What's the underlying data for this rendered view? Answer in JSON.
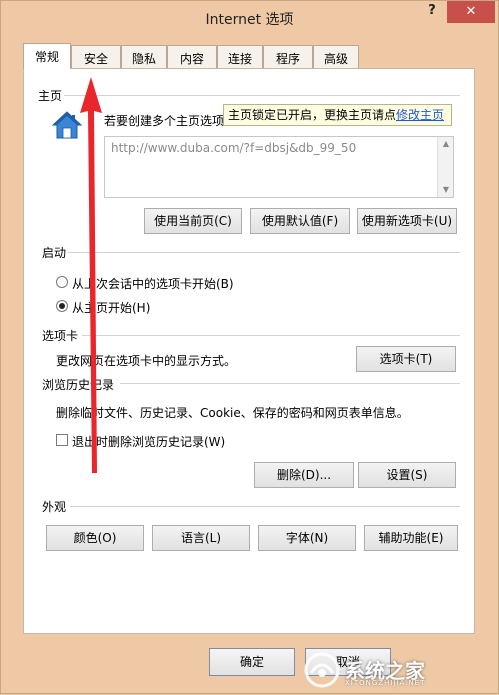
{
  "window": {
    "title": "Internet 选项",
    "help": "?",
    "close": "✕"
  },
  "tabs": [
    {
      "label": "常规",
      "active": true
    },
    {
      "label": "安全"
    },
    {
      "label": "隐私"
    },
    {
      "label": "内容"
    },
    {
      "label": "连接"
    },
    {
      "label": "程序"
    },
    {
      "label": "高级"
    }
  ],
  "homepage": {
    "section": "主页",
    "description": "若要创建多个主页选项",
    "url": "http://www.duba.com/?f=dbsj&db_99_50",
    "tooltip_text": "主页锁定已开启，更换主页请点",
    "tooltip_link": "修改主页",
    "btn_current": "使用当前页(C)",
    "btn_default": "使用默认值(F)",
    "btn_newtab": "使用新选项卡(U)"
  },
  "startup": {
    "section": "启动",
    "option_tabs": "从上次会话中的选项卡开始(B)",
    "option_home": "从主页开始(H)",
    "selected": "option_home"
  },
  "tabs_section": {
    "section": "选项卡",
    "description": "更改网页在选项卡中的显示方式。",
    "btn": "选项卡(T)"
  },
  "history": {
    "section": "浏览历史记录",
    "description": "删除临时文件、历史记录、Cookie、保存的密码和网页表单信息。",
    "checkbox": "退出时删除浏览历史记录(W)",
    "checked": false,
    "btn_delete": "删除(D)...",
    "btn_settings": "设置(S)"
  },
  "appearance": {
    "section": "外观",
    "btn_colors": "颜色(O)",
    "btn_languages": "语言(L)",
    "btn_fonts": "字体(N)",
    "btn_accessibility": "辅助功能(E)"
  },
  "footer": {
    "ok": "确定",
    "cancel": "取消"
  },
  "watermark": {
    "text": "系统之家",
    "sub": "XITONGZHIJIA.NET"
  },
  "colors": {
    "accent_arrow": "#e8262b",
    "close_bg": "#c7504a",
    "link": "#1a5ad6"
  }
}
